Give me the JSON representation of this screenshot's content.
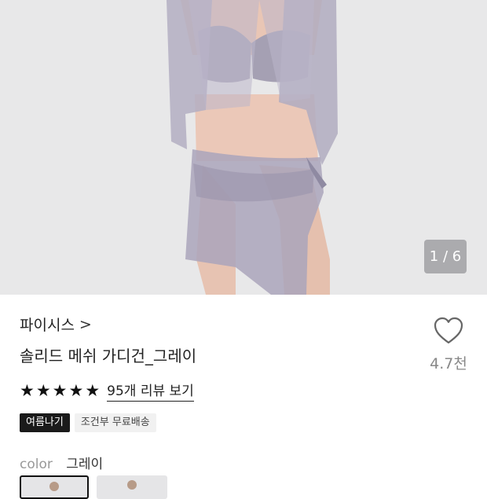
{
  "product_image": {
    "counter": "1 / 6"
  },
  "brand": {
    "name": "파이시스",
    "chevron": ">"
  },
  "product": {
    "title": "솔리드 메쉬 가디건_그레이"
  },
  "like": {
    "icon": "heart-outline-icon",
    "count": "4.7천"
  },
  "rating": {
    "stars": 5,
    "review_link": "95개 리뷰 보기"
  },
  "badges": [
    "여름나기",
    "조건부 무료배송"
  ],
  "color_option": {
    "label": "color",
    "value": "그레이"
  }
}
